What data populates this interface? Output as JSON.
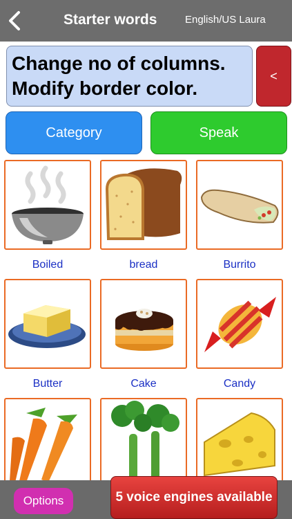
{
  "navbar": {
    "back_icon": "chevron-left-icon",
    "title": "Starter words",
    "voice": "English/US Laura"
  },
  "sentence": {
    "lines": [
      "Change no of columns.",
      "Modify border color."
    ],
    "delete_label": "<"
  },
  "actions": {
    "category_label": "Category",
    "speak_label": "Speak"
  },
  "tiles": [
    {
      "label": "Boiled",
      "icon": "boiling-pot-icon"
    },
    {
      "label": "bread",
      "icon": "bread-icon"
    },
    {
      "label": "Burrito",
      "icon": "burrito-icon"
    },
    {
      "label": "Butter",
      "icon": "butter-icon"
    },
    {
      "label": "Cake",
      "icon": "cake-icon"
    },
    {
      "label": "Candy",
      "icon": "candy-icon"
    },
    {
      "label": "",
      "icon": "carrots-icon"
    },
    {
      "label": "",
      "icon": "celery-icon"
    },
    {
      "label": "",
      "icon": "cheese-icon"
    }
  ],
  "bottom": {
    "options_label": "Options",
    "banner_label": "5 voice engines available"
  },
  "colors": {
    "navbar": "#6d6d6d",
    "sentence_bg": "#c9daf7",
    "delete": "#c0272d",
    "category": "#2e8ff0",
    "speak": "#2ecb2e",
    "tile_border": "#ea6a24",
    "tile_label": "#1a2fc4",
    "options": "#d12fb0"
  }
}
